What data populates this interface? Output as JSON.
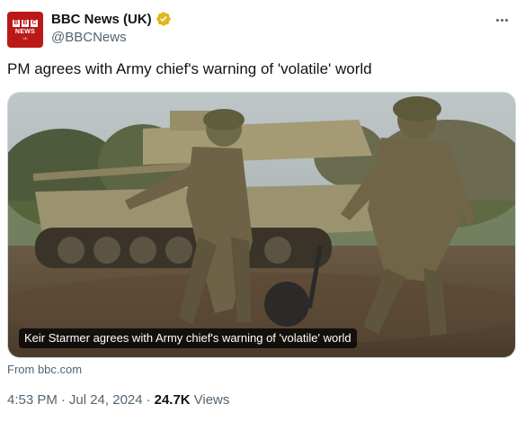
{
  "account": {
    "display_name": "BBC News (UK)",
    "handle": "@BBCNews",
    "verified_color": "#e2b719",
    "avatar": {
      "letters": [
        "B",
        "B",
        "C"
      ],
      "label": "NEWS",
      "sublabel": "UK",
      "color": "#bb1919"
    }
  },
  "icons": {
    "verified": "verified-badge-icon",
    "more": "more-options-icon"
  },
  "tweet": {
    "text": "PM agrees with Army chief's warning of 'volatile' world"
  },
  "card": {
    "caption": "Keir Starmer agrees with Army chief's warning of 'volatile' world",
    "source": "From bbc.com"
  },
  "meta": {
    "time": "4:53 PM",
    "separator": "·",
    "date": "Jul 24, 2024",
    "views_count": "24.7K",
    "views_label": "Views"
  },
  "colors": {
    "text": "#0f1419",
    "secondary": "#536471",
    "border": "#cfd9de"
  }
}
